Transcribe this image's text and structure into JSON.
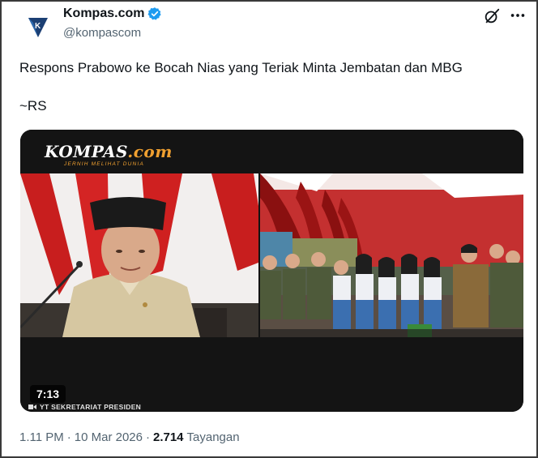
{
  "account": {
    "display_name": "Kompas.com",
    "handle": "@kompascom",
    "verified": true,
    "avatar_icon": "kompas-logo-icon"
  },
  "tweet": {
    "text": "Respons Prabowo ke Bocah Nias yang Teriak Minta Jembatan dan MBG",
    "signature": "~RS"
  },
  "media": {
    "logo_main": "KOMPAS",
    "logo_suffix": ".com",
    "tagline": "JERNIH MELIHAT DUNIA",
    "duration": "7:13",
    "source_label": "YT SEKRETARIAT PRESIDEN"
  },
  "footer": {
    "time": "1.11 PM",
    "separator": "·",
    "date": "10 Mar 2026",
    "views_count": "2.714",
    "views_label": "Tayangan"
  },
  "colors": {
    "verified": "#1d9bf0",
    "secondary_text": "#536471",
    "kompas_orange": "#f0a030"
  }
}
